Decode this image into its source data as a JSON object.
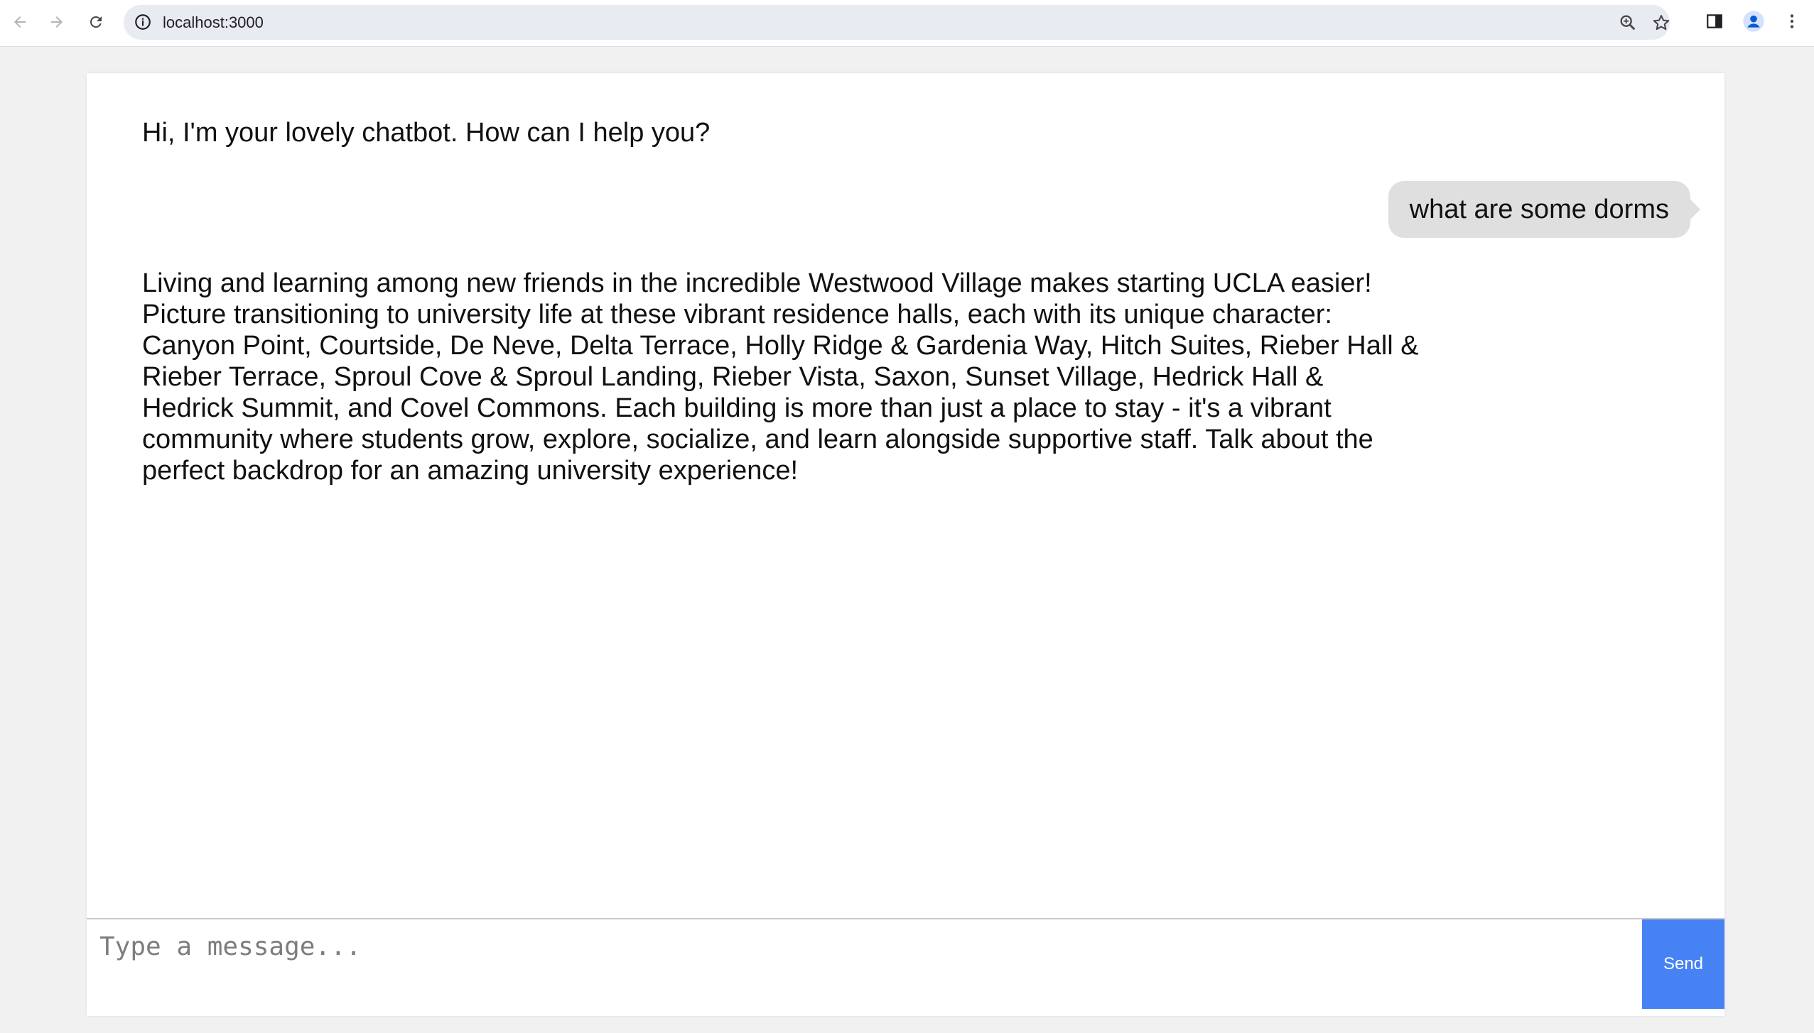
{
  "browser": {
    "url": "localhost:3000",
    "icons": {
      "back": "back-arrow-icon",
      "forward": "forward-arrow-icon",
      "reload": "reload-icon",
      "site_info": "info-icon",
      "zoom": "zoom-icon",
      "bookmark": "star-icon",
      "side_panel": "side-panel-icon",
      "profile": "profile-icon",
      "menu": "more-vert-icon"
    }
  },
  "chat": {
    "messages": [
      {
        "role": "bot",
        "text": "Hi, I'm your lovely chatbot. How can I help you?"
      },
      {
        "role": "user",
        "text": "what are some dorms"
      },
      {
        "role": "bot",
        "text": "Living and learning among new friends in the incredible Westwood Village makes starting UCLA easier! Picture transitioning to university life at these vibrant residence halls, each with its unique character: Canyon Point, Courtside, De Neve, Delta Terrace, Holly Ridge & Gardenia Way, Hitch Suites, Rieber Hall & Rieber Terrace, Sproul Cove & Sproul Landing, Rieber Vista, Saxon, Sunset Village, Hedrick Hall & Hedrick Summit, and Covel Commons. Each building is more than just a place to stay - it's a vibrant community where students grow, explore, socialize, and learn alongside supportive staff. Talk about the perfect backdrop for an amazing university experience!"
      }
    ],
    "input": {
      "value": "",
      "placeholder": "Type a message..."
    },
    "send_label": "Send",
    "colors": {
      "send_button": "#4682f4",
      "user_bubble": "#dfdfdf"
    }
  }
}
